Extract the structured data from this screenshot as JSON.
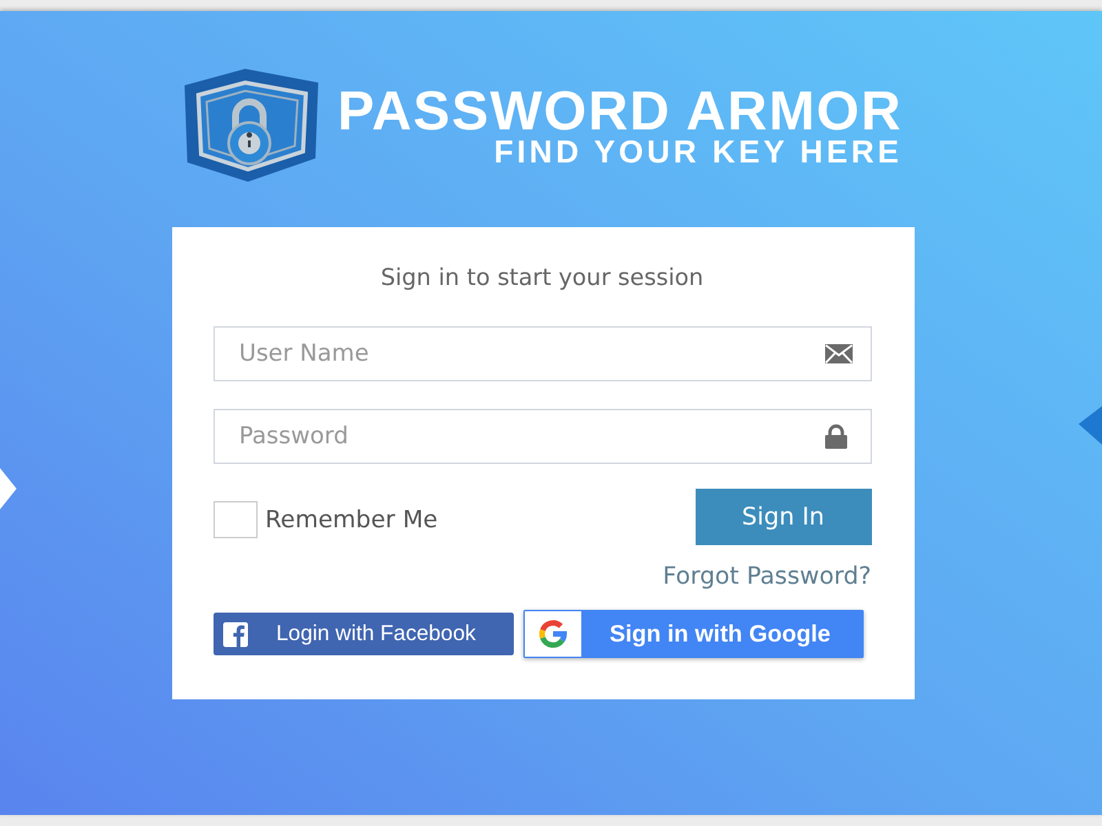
{
  "brand": {
    "title": "PASSWORD ARMOR",
    "tagline": "FIND YOUR KEY HERE"
  },
  "login_box": {
    "heading": "Sign in to start your session",
    "fields": [
      {
        "kind": "text",
        "placeholder": "User Name"
      },
      {
        "kind": "password",
        "placeholder": "Password"
      }
    ],
    "remember": {
      "label": "Remember Me",
      "checked": false
    },
    "submit": "Sign In",
    "forgot_link": "Forgot Password?",
    "social": [
      {
        "kind": "facebook",
        "label": "Login with Facebook"
      },
      {
        "kind": "google",
        "label": "Sign in with Google"
      }
    ]
  }
}
